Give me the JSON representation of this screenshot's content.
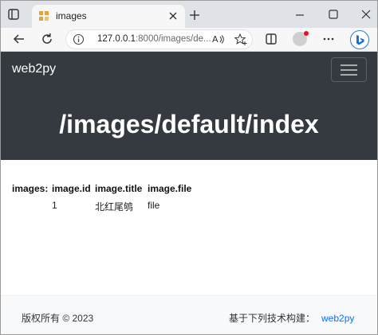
{
  "browser": {
    "tab_title": "images",
    "url_host": "127.0.0.1",
    "url_rest": ":8000/images/de...",
    "icons": [
      "window-menu-icon",
      "favicon-icon",
      "close-icon",
      "plus-icon",
      "minimize-icon",
      "maximize-icon",
      "close-window-icon",
      "back-icon",
      "refresh-icon",
      "info-icon",
      "read-aloud-icon",
      "favorite-add-icon",
      "split-screen-icon",
      "profile-icon",
      "more-icon",
      "bing-icon"
    ]
  },
  "page": {
    "brand": "web2py",
    "heading": "/images/default/index",
    "table_label": "images",
    "columns": [
      "image.id",
      "image.title",
      "image.file"
    ],
    "rows": [
      [
        "1",
        "北红尾鸲",
        "file"
      ]
    ],
    "footer_copyright": "版权所有 © 2023",
    "footer_powered": "基于下列技术构建：",
    "footer_link": "web2py",
    "link_color": "#0d6efd",
    "navbar_color": "#343a40"
  }
}
